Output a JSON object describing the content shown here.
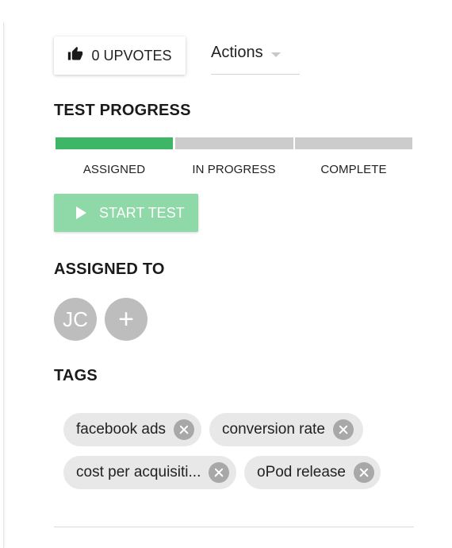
{
  "header": {
    "upvote_label": "0 UPVOTES",
    "upvote_icon": "thumbs-up-icon",
    "actions_label": "Actions",
    "actions_icon": "chevron-down-icon"
  },
  "progress": {
    "title": "TEST PROGRESS",
    "stages": [
      "ASSIGNED",
      "IN PROGRESS",
      "COMPLETE"
    ],
    "current_stage": "ASSIGNED",
    "completed_fraction": 0.333,
    "colors": {
      "done": "#3db766",
      "pending": "#cccccc"
    }
  },
  "start_button": {
    "label": "START TEST",
    "icon": "play-icon",
    "color": "#8fd9a8"
  },
  "assigned": {
    "title": "ASSIGNED TO",
    "avatar_initials": "JC",
    "add_icon": "+"
  },
  "tags": {
    "title": "TAGS",
    "items": [
      "facebook ads",
      "conversion rate",
      "cost per acquisiti...",
      "oPod release"
    ],
    "remove_icon": "close-circle-icon"
  }
}
